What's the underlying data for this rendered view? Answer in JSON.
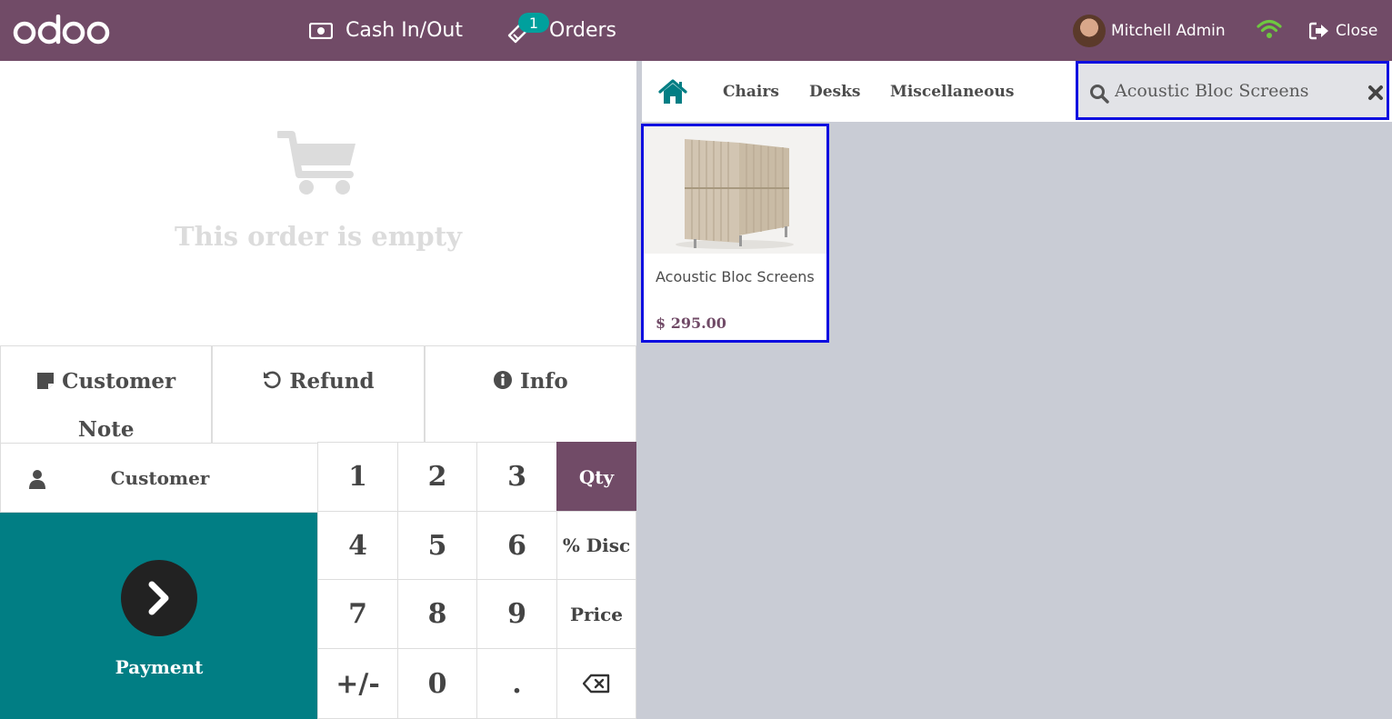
{
  "topbar": {
    "logo_text": "odoo",
    "cash_label": "Cash In/Out",
    "orders_label": "Orders",
    "orders_badge": "1",
    "user_name": "Mitchell Admin",
    "close_label": "Close",
    "bg_color": "#714b67",
    "wifi_status": "connected"
  },
  "order": {
    "empty_text": "This order is empty",
    "icon": "shopping-cart-icon"
  },
  "controls": {
    "customer_note_line1": "Customer",
    "customer_note_line2": "Note",
    "refund": "Refund",
    "info": "Info"
  },
  "pad": {
    "customer": "Customer",
    "payment": "Payment",
    "keys": [
      "1",
      "2",
      "3",
      "Qty",
      "4",
      "5",
      "6",
      "% Disc",
      "7",
      "8",
      "9",
      "Price",
      "+/-",
      "0",
      ".",
      "backspace"
    ],
    "active_mode": "Qty",
    "accent": "#017e84"
  },
  "categories": {
    "items": [
      "Chairs",
      "Desks",
      "Miscellaneous"
    ]
  },
  "search": {
    "value": "Acoustic Bloc Screens"
  },
  "products": [
    {
      "name": "Acoustic Bloc Screens",
      "price": "$ 295.00"
    }
  ]
}
